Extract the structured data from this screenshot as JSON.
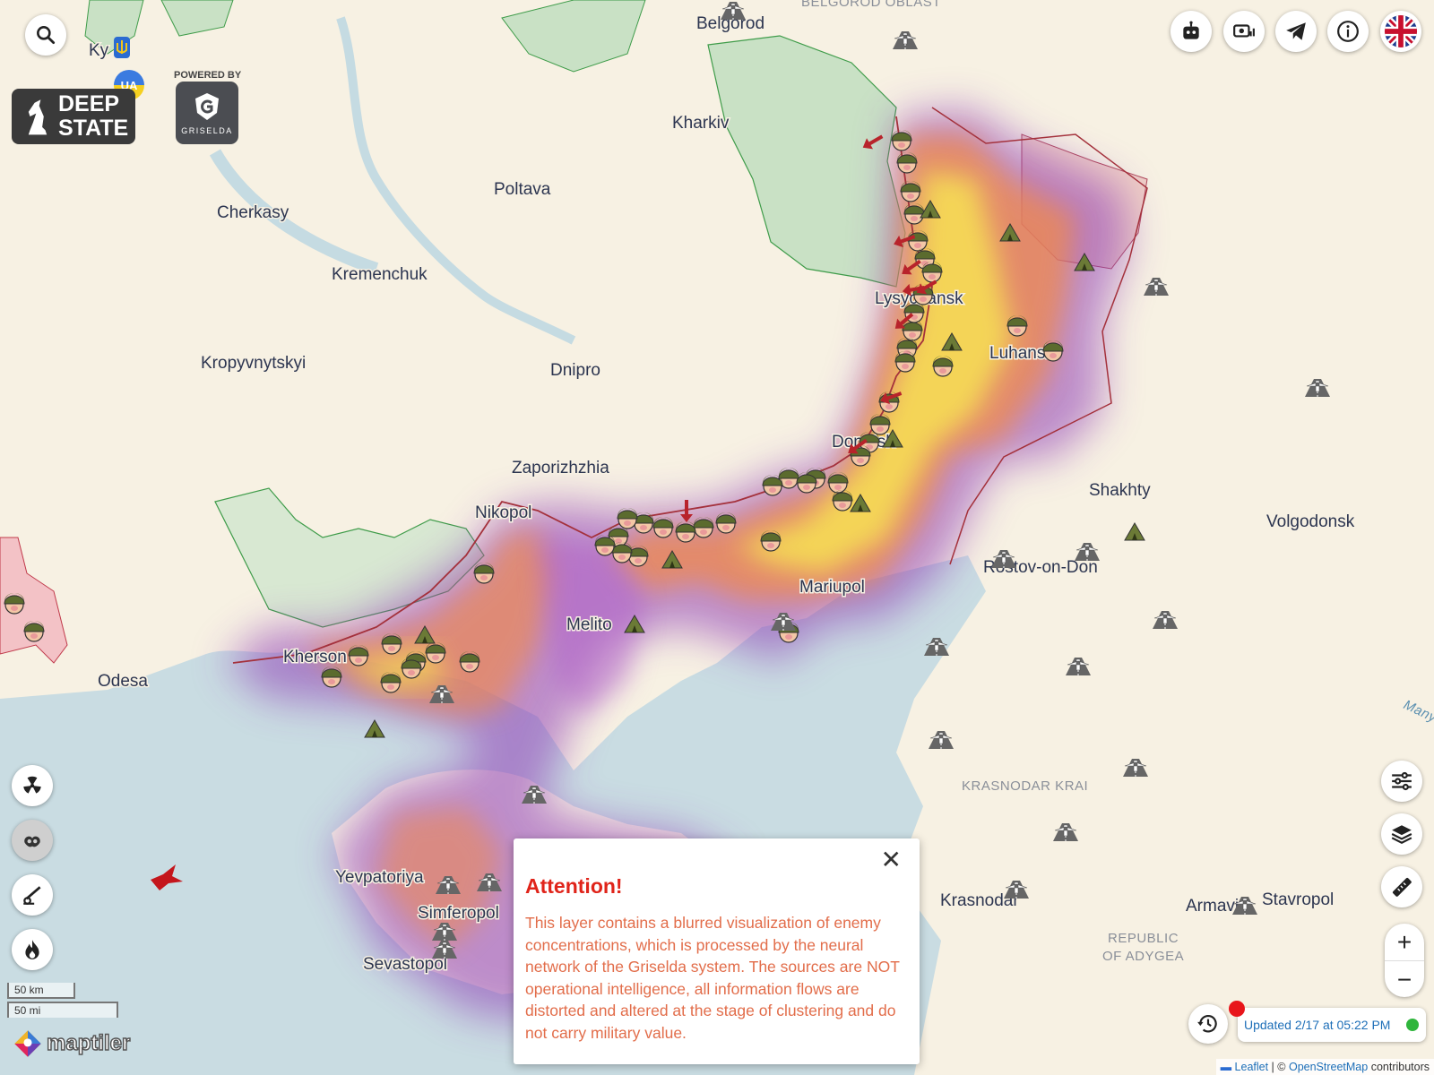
{
  "branding": {
    "deepstate_line1": "DEEP",
    "deepstate_line2": "STATE",
    "powered_by": "POWERED BY",
    "griselda": "GRISELDA",
    "ua_badge": "UA"
  },
  "map": {
    "cities": [
      "Ky",
      "Belgorod",
      "Kharkiv",
      "Poltava",
      "Cherkasy",
      "Kremenchuk",
      "Kropyvnytskyi",
      "Dnipro",
      "Zaporizhzhia",
      "Nikopol",
      "Melito",
      "Kherson",
      "Odesa",
      "Mariupol",
      "Lysychansk",
      "Luhansk",
      "Donetsk",
      "Shakhty",
      "Volgodonsk",
      "Rostov-on-Don",
      "Yevpatoriya",
      "Simferopol",
      "Sevastopol",
      "Krasnodar",
      "Armavir",
      "Stavropol"
    ],
    "regions": [
      "BELGOROD OBLAST",
      "KRASNODAR KRAI",
      "REPUBLIC",
      "OF ADYGEA",
      "Manych"
    ]
  },
  "icons": {
    "search": "search-icon",
    "bot": "robot-icon",
    "donate": "money-icon",
    "telegram": "telegram-icon",
    "info": "info-icon",
    "language": "uk-flag-icon",
    "nuclear": "radiation-icon",
    "heatmap": "heatmap-layer-icon",
    "artillery": "artillery-icon",
    "fire": "fire-icon",
    "filters": "sliders-icon",
    "layers": "layers-icon",
    "ruler": "ruler-icon",
    "history": "history-icon"
  },
  "popup": {
    "title": "Attention!",
    "body": "This layer contains a blurred visualization of enemy concentrations, which is processed by the neural network of the Griselda system. The sources are NOT operational intelligence, all information flows are distorted and altered at the stage of clustering and do not carry military value.",
    "close": "✕"
  },
  "zoom": {
    "plus": "+",
    "minus": "−"
  },
  "status": {
    "updated": "Updated 2/17 at 05:22 PM"
  },
  "scale": {
    "km": "50 km",
    "mi": "50 mi"
  },
  "attribution": {
    "leaflet": "Leaflet",
    "sep": " | © ",
    "osm": "OpenStreetMap",
    "contrib": " contributors"
  },
  "maptiler": "maptiler"
}
